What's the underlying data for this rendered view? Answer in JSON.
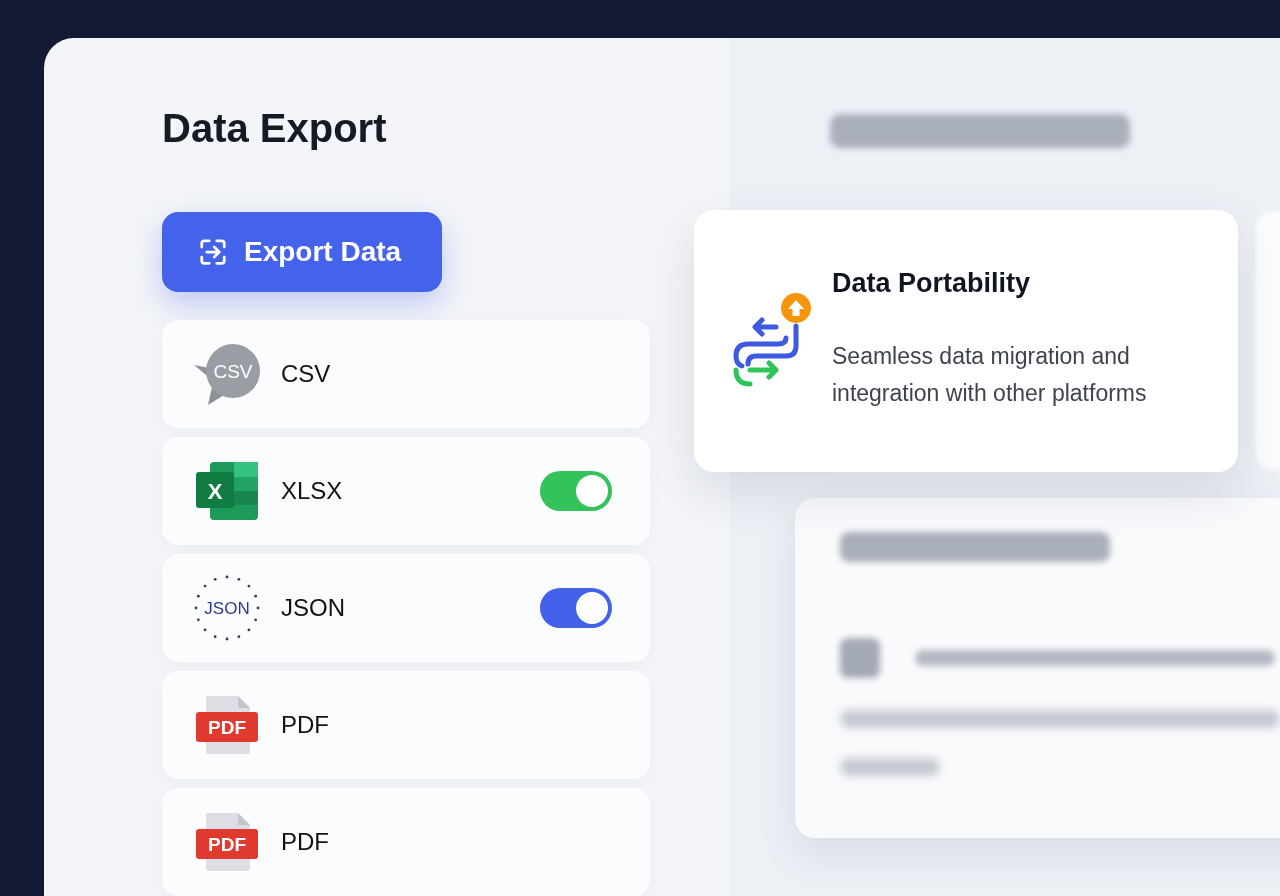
{
  "title": "Data Export",
  "export_button": {
    "label": "Export Data"
  },
  "formats": [
    {
      "kind": "csv",
      "icon_label": "CSV",
      "label": "CSV"
    },
    {
      "kind": "xlsx",
      "icon_label": "X",
      "label": "XLSX",
      "toggle": {
        "on": true,
        "color": "#34c25a"
      }
    },
    {
      "kind": "json",
      "icon_label": "JSON",
      "label": "JSON",
      "toggle": {
        "on": true,
        "color": "#4461ea"
      }
    },
    {
      "kind": "pdf",
      "icon_label": "PDF",
      "label": "PDF"
    },
    {
      "kind": "pdf",
      "icon_label": "PDF",
      "label": "PDF"
    }
  ],
  "feature_card": {
    "title": "Data Portability",
    "description": "Seamless data migration and integration with other platforms"
  }
}
